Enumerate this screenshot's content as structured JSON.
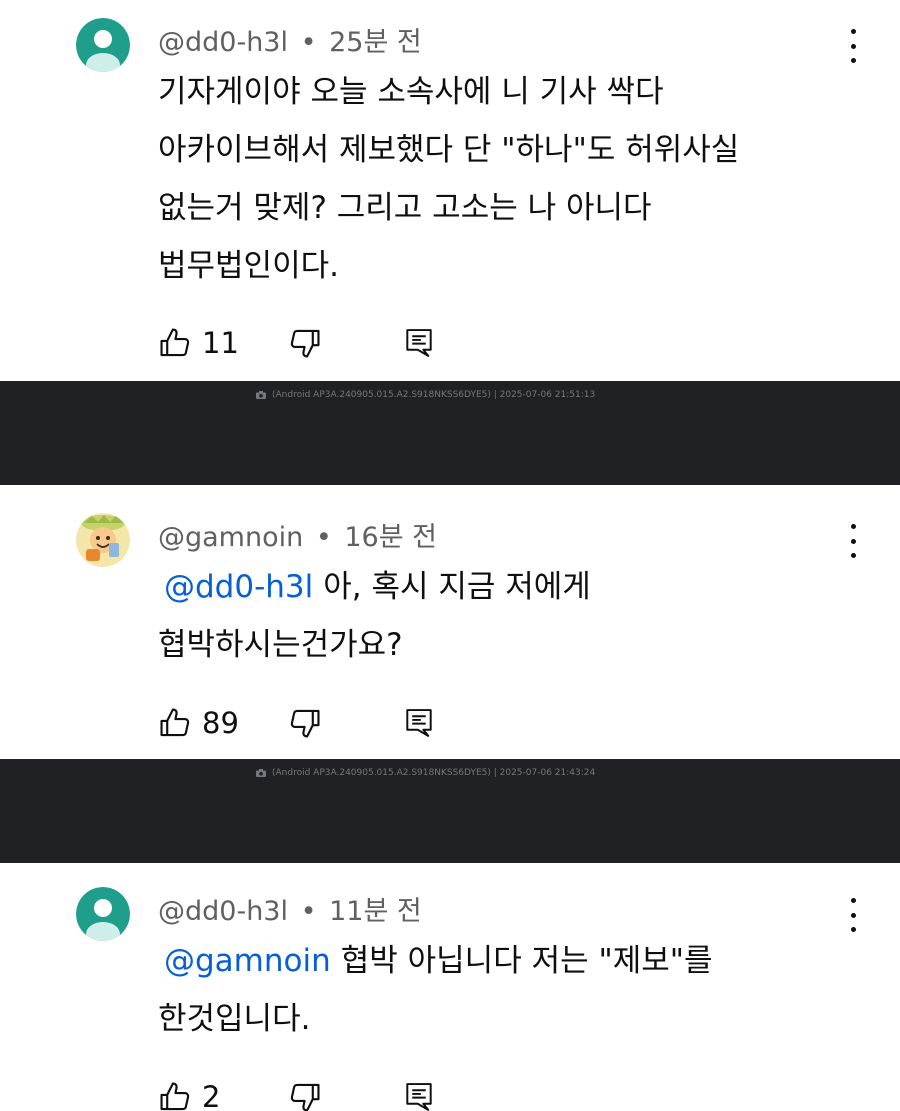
{
  "comments": [
    {
      "username": "@dd0-h3l",
      "separator": "•",
      "time": "25분 전",
      "body_lines": [
        "기자게이야 오늘 소속사에 니 기사 싹다",
        "아카이브해서 제보했다 단 \"하나\"도 허위사실",
        "없는거 맞제? 그리고 고소는 나 아니다",
        "법무법인이다."
      ],
      "likes": "11",
      "avatar": "default-person-avatar"
    },
    {
      "username": "@gamnoin",
      "separator": "•",
      "time": "16분 전",
      "mention": "@dd0-h3l",
      "body_lines": [
        "아, 혹시 지금 저에게",
        "협박하시는건가요?"
      ],
      "likes": "89",
      "avatar": "cartoon-character-avatar"
    },
    {
      "username": "@dd0-h3l",
      "separator": "•",
      "time": "11분 전",
      "mention": "@gamnoin",
      "body_lines": [
        "협박 아닙니다 저는 \"제보\"를",
        "한것입니다."
      ],
      "likes": "2",
      "avatar": "default-person-avatar"
    }
  ],
  "screenshot_stamps": [
    "(Android AP3A.240905.015.A2.S918NKSS6DYE5) | 2025-07-06 21:51:13",
    "(Android AP3A.240905.015.A2.S918NKSS6DYE5) | 2025-07-06 21:43:24"
  ],
  "colors": {
    "mention": "#065fd4",
    "text": "#0f0f0f",
    "meta": "#606060",
    "avatar_default": "#1f9e8c",
    "gap": "#202124"
  }
}
